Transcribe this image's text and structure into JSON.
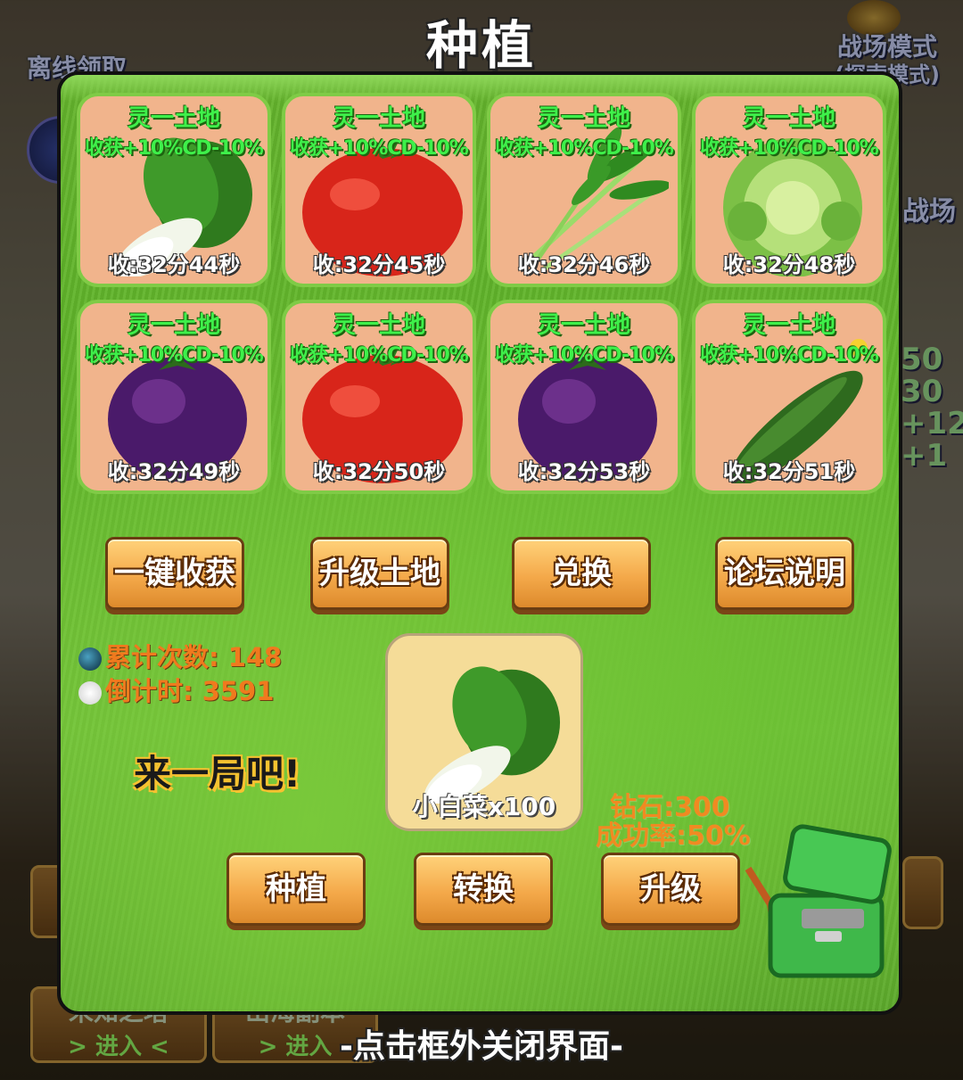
{
  "title": "种植",
  "background": {
    "left_top_label": "离线领取",
    "right_top_label_1": "战场模式",
    "right_top_label_2": "(探索模式)",
    "right_label": "战场",
    "right_stats": [
      "50",
      "30",
      "+12",
      "+1"
    ],
    "bottom_btn_1_title": "未知之塔",
    "bottom_btn_1_enter": "> 进入 <",
    "bottom_btn_2_title": "山海副本",
    "bottom_btn_2_enter": "> 进入"
  },
  "plots": [
    {
      "name": "灵一土地",
      "bonus": "收获+10%CD-10%",
      "time": "收:32分44秒",
      "crop": "bok-choy"
    },
    {
      "name": "灵一土地",
      "bonus": "收获+10%CD-10%",
      "time": "收:32分45秒",
      "crop": "tomato"
    },
    {
      "name": "灵一土地",
      "bonus": "收获+10%CD-10%",
      "time": "收:32分46秒",
      "crop": "water-spinach"
    },
    {
      "name": "灵一土地",
      "bonus": "收获+10%CD-10%",
      "time": "收:32分48秒",
      "crop": "lettuce"
    },
    {
      "name": "灵一土地",
      "bonus": "收获+10%CD-10%",
      "time": "收:32分49秒",
      "crop": "eggplant"
    },
    {
      "name": "灵一土地",
      "bonus": "收获+10%CD-10%",
      "time": "收:32分50秒",
      "crop": "tomato"
    },
    {
      "name": "灵一土地",
      "bonus": "收获+10%CD-10%",
      "time": "收:32分53秒",
      "crop": "eggplant"
    },
    {
      "name": "灵一土地",
      "bonus": "收获+10%CD-10%",
      "time": "收:32分51秒",
      "crop": "cucumber"
    }
  ],
  "actions": {
    "harvest_all": "一键收获",
    "upgrade_land": "升级土地",
    "exchange": "兑换",
    "forum": "论坛说明"
  },
  "stats": {
    "total_count": "累计次数: 148",
    "countdown": "倒计时: 3591"
  },
  "prompt": "来一局吧!",
  "seed": {
    "label": "小白菜x100",
    "crop": "bok-choy"
  },
  "cost": {
    "diamonds": "钻石:300",
    "success_rate": "成功率:50%"
  },
  "bottom_actions": {
    "plant": "种植",
    "convert": "转换",
    "upgrade": "升级"
  },
  "close_hint": "-点击框外关闭界面-",
  "colors": {
    "plot_bg": "#f1b48c",
    "plot_text_green": "#3ef04a",
    "button_orange": "#f4a94a",
    "cost_orange": "#f08a22"
  }
}
